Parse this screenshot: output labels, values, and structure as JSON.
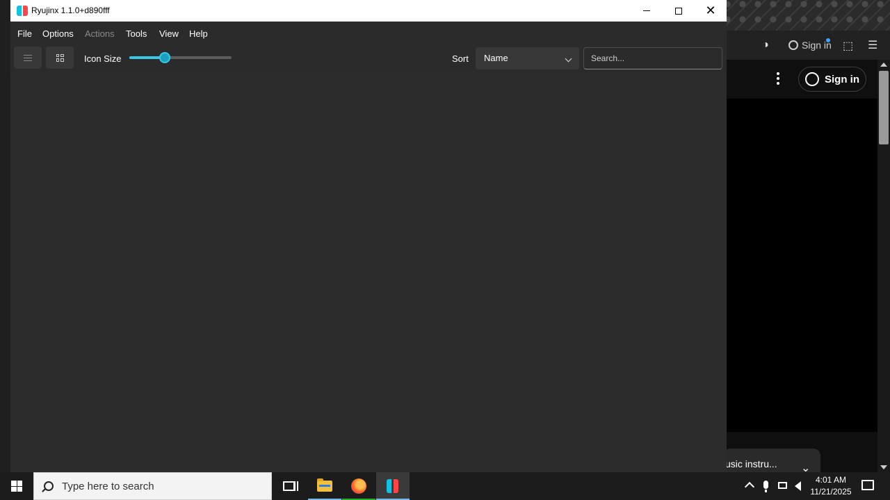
{
  "window": {
    "title": "Ryujinx 1.1.0+d890fff"
  },
  "menu": {
    "file": "File",
    "options": "Options",
    "actions": "Actions",
    "tools": "Tools",
    "view": "View",
    "help": "Help"
  },
  "toolbar": {
    "icon_size_label": "Icon Size",
    "icon_size_value": 0.35,
    "sort_label": "Sort",
    "sort_value": "Name",
    "search_placeholder": "Search..."
  },
  "background_browser": {
    "sign_in_small": "Sign in",
    "sign_in_button": "Sign in",
    "toast_text": "usic instru..."
  },
  "taskbar": {
    "search_placeholder": "Type here to search",
    "time": "4:01 AM",
    "date": "11/21/2025"
  },
  "colors": {
    "accent": "#3cc6e6",
    "window_bg": "#2b2b2b",
    "titlebar_bg": "#ffffff",
    "taskbar_bg": "#1c1c1c"
  },
  "icons": {
    "list_view": "list-icon",
    "grid_view": "grid-icon",
    "sort_dropdown": "chevron-down-icon",
    "minimize": "minimize-icon",
    "maximize": "maximize-icon",
    "close": "close-icon"
  }
}
